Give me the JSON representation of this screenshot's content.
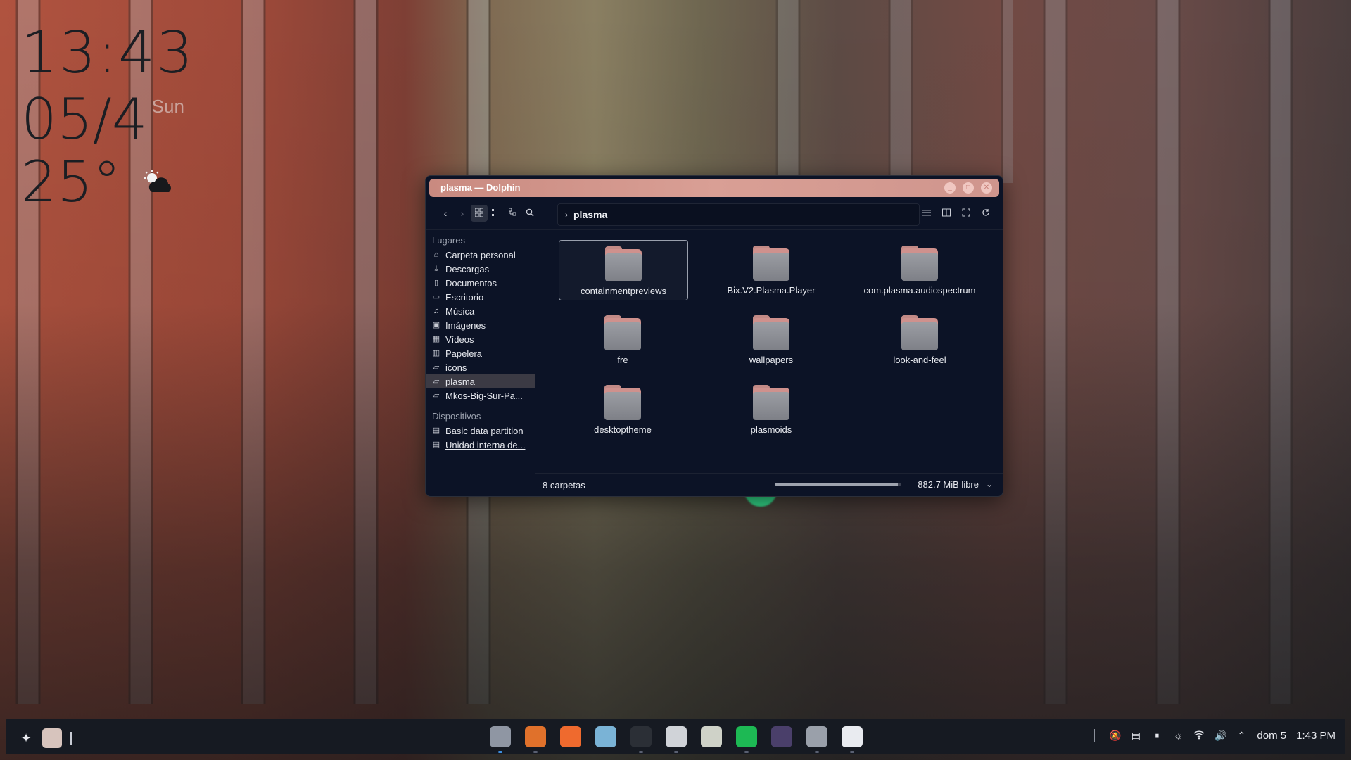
{
  "desktop": {
    "clock": "13:43",
    "date": "05/4",
    "day_of_week": "Sun",
    "temperature": "25°",
    "weather_icon": "partly-cloudy-night-icon"
  },
  "window": {
    "title": "plasma — Dolphin",
    "buttons": [
      "minimize",
      "maximize",
      "close"
    ],
    "path": {
      "current": "plasma"
    },
    "sidebar": {
      "places_header": "Lugares",
      "places": [
        {
          "label": "Carpeta personal",
          "icon": "home-icon"
        },
        {
          "label": "Descargas",
          "icon": "download-icon"
        },
        {
          "label": "Documentos",
          "icon": "document-icon"
        },
        {
          "label": "Escritorio",
          "icon": "desktop-icon"
        },
        {
          "label": "Música",
          "icon": "music-icon"
        },
        {
          "label": "Imágenes",
          "icon": "image-icon"
        },
        {
          "label": "Vídeos",
          "icon": "video-icon"
        },
        {
          "label": "Papelera",
          "icon": "trash-icon"
        },
        {
          "label": "icons",
          "icon": "folder-icon"
        },
        {
          "label": "plasma",
          "icon": "folder-icon",
          "selected": true
        },
        {
          "label": "Mkos-Big-Sur-Pa...",
          "icon": "folder-icon"
        }
      ],
      "devices_header": "Dispositivos",
      "devices": [
        {
          "label": "Basic data partition",
          "icon": "drive-icon"
        },
        {
          "label": "Unidad interna de...",
          "icon": "drive-icon"
        }
      ]
    },
    "folders": [
      {
        "name": "containmentpreviews",
        "selected": true
      },
      {
        "name": "Bix.V2.Plasma.Player"
      },
      {
        "name": "com.plasma.audiospectrum"
      },
      {
        "name": "fre"
      },
      {
        "name": "wallpapers"
      },
      {
        "name": "look-and-feel"
      },
      {
        "name": "desktoptheme"
      },
      {
        "name": "plasmoids"
      }
    ],
    "status": {
      "count": "8 carpetas",
      "free_space": "882.7 MiB libre",
      "usage_fraction": 0.97
    }
  },
  "taskbar": {
    "dock_apps": [
      {
        "name": "files",
        "color": "#8f96a3",
        "running": true
      },
      {
        "name": "firefox",
        "color": "#e0712b",
        "running": true
      },
      {
        "name": "app-store",
        "color": "#ef6a2e",
        "running": false
      },
      {
        "name": "image-viewer",
        "color": "#7ab3d6",
        "running": false
      },
      {
        "name": "terminal",
        "color": "#2b2f36",
        "running": true
      },
      {
        "name": "settings",
        "color": "#d0d3d8",
        "running": true
      },
      {
        "name": "text-editor",
        "color": "#cfd2c8",
        "running": false
      },
      {
        "name": "spotify",
        "color": "#1db954",
        "running": true
      },
      {
        "name": "bottles",
        "color": "#4a3f6a",
        "running": false
      },
      {
        "name": "folder-app",
        "color": "#9aa0aa",
        "running": true
      },
      {
        "name": "notes",
        "color": "#e9ebf0",
        "running": true
      }
    ],
    "tray": {
      "date": "dom 5",
      "time": "1:43 PM"
    }
  }
}
